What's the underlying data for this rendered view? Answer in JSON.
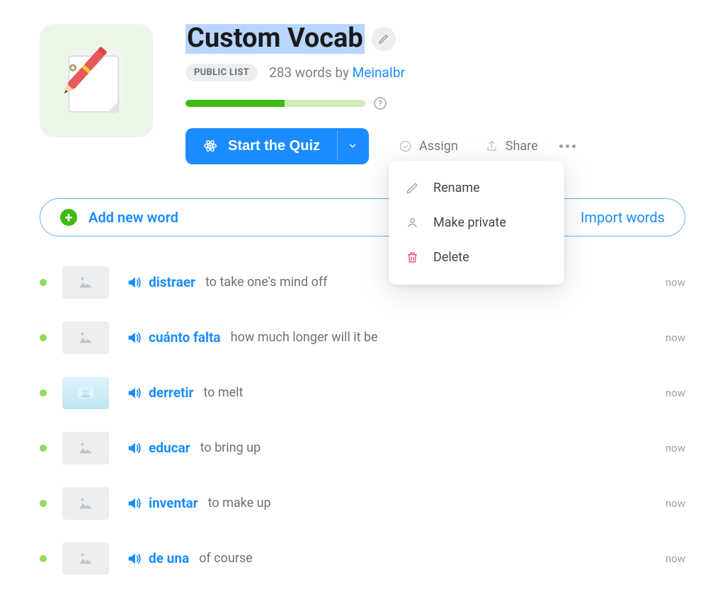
{
  "header": {
    "title": "Custom Vocab",
    "badge_label": "PUBLIC LIST",
    "word_count_text": "283 words by ",
    "author": "MeinaIbr",
    "progress_help": "?"
  },
  "actions": {
    "quiz_label": "Start the Quiz",
    "assign_label": "Assign",
    "share_label": "Share"
  },
  "dropdown": {
    "rename": "Rename",
    "make_private": "Make private",
    "delete": "Delete"
  },
  "addbar": {
    "add_label": "Add new word",
    "import_label": "Import words"
  },
  "words": [
    {
      "term": "distraer",
      "def": "to take one's mind off",
      "time": "now",
      "has_image": false
    },
    {
      "term": "cuánto falta",
      "def": "how much longer will it be",
      "time": "now",
      "has_image": false
    },
    {
      "term": "derretir",
      "def": "to melt",
      "time": "now",
      "has_image": true
    },
    {
      "term": "educar",
      "def": "to bring up",
      "time": "now",
      "has_image": false
    },
    {
      "term": "inventar",
      "def": "to make up",
      "time": "now",
      "has_image": false
    },
    {
      "term": "de una",
      "def": "of course",
      "time": "now",
      "has_image": false
    }
  ]
}
